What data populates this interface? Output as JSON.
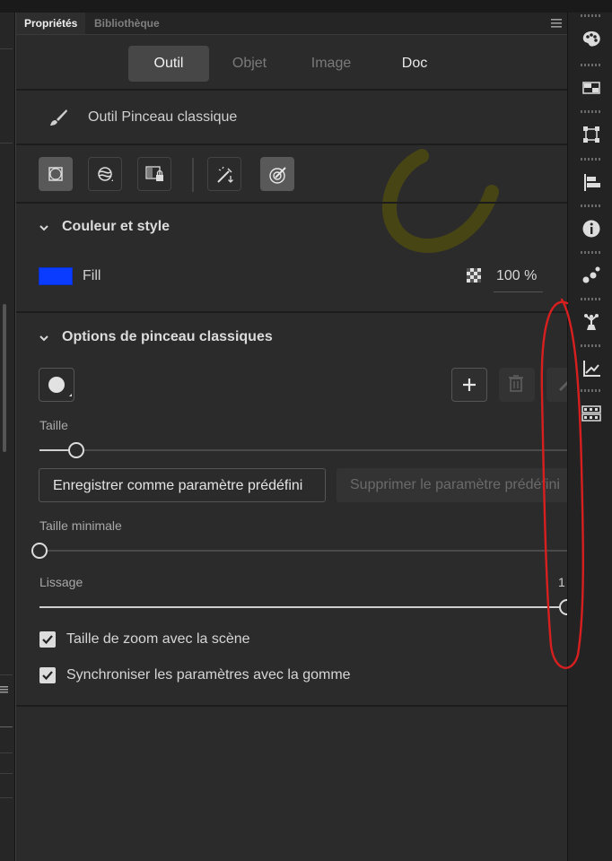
{
  "panel_tabs": {
    "properties": "Propriétés",
    "library": "Bibliothèque"
  },
  "segments": {
    "tool": "Outil",
    "object": "Objet",
    "image": "Image",
    "doc": "Doc"
  },
  "tool_title": "Outil Pinceau classique",
  "color_section": {
    "title": "Couleur et style",
    "fill_label": "Fill",
    "fill_color": "#0a3cff",
    "opacity": "100 %"
  },
  "brush_section": {
    "title": "Options de pinceau classiques",
    "size_label": "Taille",
    "save_preset": "Enregistrer comme paramètre prédéfini",
    "delete_preset": "Supprimer le paramètre prédéfini",
    "min_size_label": "Taille minimale",
    "smoothing_label": "Lissage",
    "smoothing_value_visible": "1",
    "zoom_size": "Taille de zoom avec la scène",
    "sync_eraser": "Synchroniser les paramètres avec la gomme",
    "size_level": 0.07,
    "min_size_level": 0.0,
    "smoothing_level": 1.0
  },
  "colors": {
    "accent_annotation": "#d81f1f",
    "panel_bg": "#2b2b2b"
  },
  "dock_icons": [
    "color-palette-icon",
    "swatches-icon",
    "transform-icon",
    "align-icon",
    "info-icon",
    "assets-icon",
    "components-icon",
    "motion-graph-icon",
    "frame-picker-icon"
  ]
}
